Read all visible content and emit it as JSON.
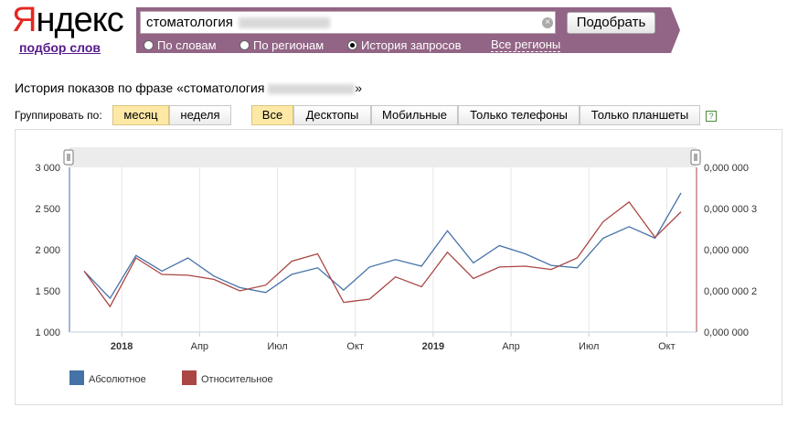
{
  "logo": {
    "first": "Я",
    "rest": "ндекс"
  },
  "sub_link": "подбор слов",
  "search": {
    "query": "стоматология",
    "submit": "Подобрать",
    "radios": [
      "По словам",
      "По регионам",
      "История запросов"
    ],
    "regions": "Все регионы",
    "clear_icon": "clear-icon"
  },
  "title": {
    "prefix": "История показов по фразе «стоматология",
    "suffix": "»"
  },
  "grouping": {
    "label": "Группировать по:",
    "options": [
      "месяц",
      "неделя"
    ]
  },
  "devices": [
    "Все",
    "Десктопы",
    "Мобильные",
    "Только телефоны",
    "Только планшеты"
  ],
  "help": "?",
  "colors": {
    "absolute": "#4572a7",
    "relative": "#aa4643",
    "accent": "#926485"
  },
  "chart_data": {
    "type": "line",
    "x_labels": [
      "2018",
      "Апр",
      "Июл",
      "Окт",
      "2019",
      "Апр",
      "Июл",
      "Окт"
    ],
    "y_left": {
      "ticks": [
        "3 000",
        "2 500",
        "2 000",
        "1 500",
        "1 000"
      ],
      "range": [
        1000,
        3000
      ]
    },
    "y_right": {
      "ticks": [
        "0,000 000",
        "0,000 000 3",
        "0,000 000",
        "0,000 000 2",
        "0,000 000"
      ]
    },
    "series": [
      {
        "name": "Абсолютное",
        "values": [
          1740,
          1410,
          1930,
          1740,
          1900,
          1680,
          1540,
          1480,
          1700,
          1780,
          1510,
          1790,
          1880,
          1800,
          2230,
          1840,
          2050,
          1950,
          1810,
          1780,
          2140,
          2280,
          2140,
          2690
        ]
      },
      {
        "name": "Относительное",
        "values": [
          1740,
          1310,
          1900,
          1700,
          1690,
          1640,
          1500,
          1570,
          1860,
          1950,
          1360,
          1400,
          1670,
          1550,
          1970,
          1650,
          1790,
          1800,
          1760,
          1900,
          2340,
          2580,
          2150,
          2460
        ]
      }
    ],
    "legend": [
      "Абсолютное",
      "Относительное"
    ],
    "grid": true
  }
}
